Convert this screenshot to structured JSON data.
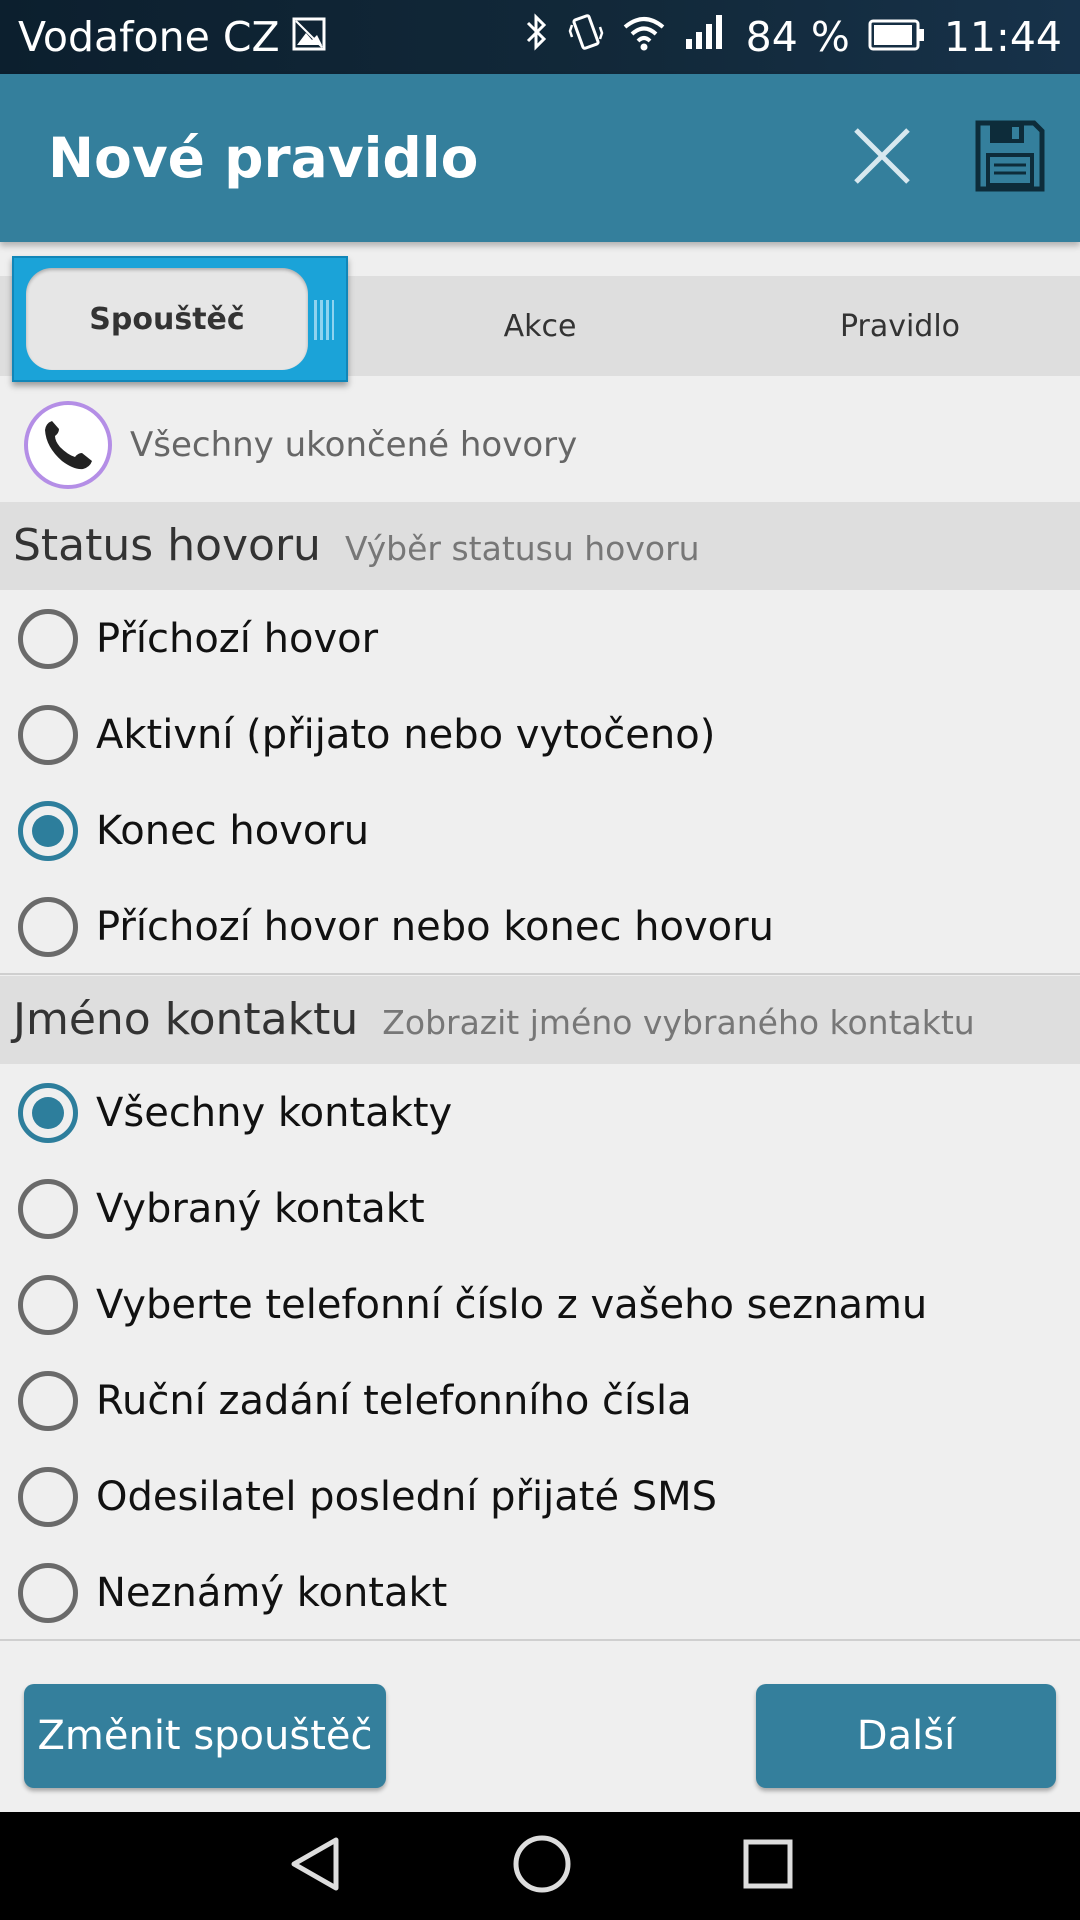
{
  "status_bar": {
    "carrier": "Vodafone CZ",
    "battery": "84 %",
    "time": "11:44",
    "icons": [
      "image-icon",
      "bluetooth-icon",
      "vibrate-icon",
      "wifi-icon",
      "signal-icon",
      "battery-icon"
    ]
  },
  "app_bar": {
    "title": "Nové pravidlo",
    "close_icon": "close-icon",
    "save_icon": "save-icon",
    "background": "#347f9c"
  },
  "tabs": [
    {
      "label": "Spouštěč",
      "active": true
    },
    {
      "label": "Akce",
      "active": false
    },
    {
      "label": "Pravidlo",
      "active": false
    }
  ],
  "trigger": {
    "icon": "phone-icon",
    "label": "Všechny ukončené hovory"
  },
  "call_status": {
    "heading": "Status hovoru",
    "subheading": "Výběr statusu hovoru",
    "options": [
      {
        "label": "Příchozí hovor",
        "selected": false
      },
      {
        "label": "Aktivní (přijato nebo vytočeno)",
        "selected": false
      },
      {
        "label": "Konec hovoru",
        "selected": true
      },
      {
        "label": "Příchozí hovor nebo konec hovoru",
        "selected": false
      }
    ]
  },
  "contact_name": {
    "heading": "Jméno kontaktu",
    "subheading": "Zobrazit jméno vybraného kontaktu",
    "options": [
      {
        "label": "Všechny kontakty",
        "selected": true
      },
      {
        "label": "Vybraný kontakt",
        "selected": false
      },
      {
        "label": "Vyberte telefonní číslo z vašeho seznamu",
        "selected": false
      },
      {
        "label": "Ruční zadání telefonního čísla",
        "selected": false
      },
      {
        "label": "Odesilatel poslední přijaté SMS",
        "selected": false
      },
      {
        "label": "Neznámý kontakt",
        "selected": false
      }
    ]
  },
  "buttons": {
    "change_trigger": "Změnit spouštěč",
    "next": "Další"
  },
  "nav_bar": {
    "icons": [
      "back-icon",
      "home-icon",
      "recents-icon"
    ]
  }
}
